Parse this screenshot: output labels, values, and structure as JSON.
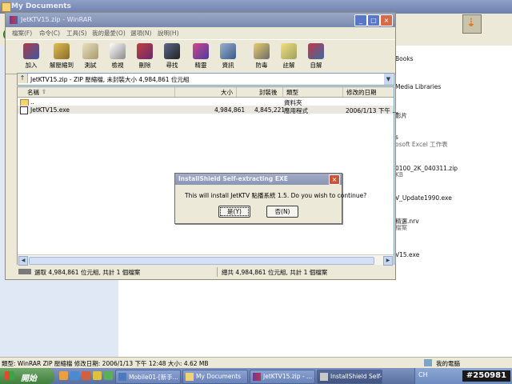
{
  "background_window": {
    "title": "My Documents",
    "right_items": [
      {
        "name": "Books",
        "detail": ""
      },
      {
        "name": "Media Libraries",
        "detail": ""
      },
      {
        "name": "影片",
        "detail": ""
      },
      {
        "name": "s",
        "detail": "osoft Excel 工作表"
      },
      {
        "name": "0100_2K_040311.zip",
        "detail": "KB"
      },
      {
        "name": "V_Update1990.exe",
        "detail": ""
      },
      {
        "name": "精選.nrv",
        "detail": "檔案"
      },
      {
        "name": "V15.exe",
        "detail": ""
      }
    ],
    "status_text": "類型: WinRAR ZIP 壓縮檔 修改日期: 2006/1/13 下午 12:48 大小: 4.62 MB",
    "status_right": "我的電腦"
  },
  "winrar": {
    "title": "JetKTV15.zip - WinRAR",
    "menu": [
      "檔案(F)",
      "命令(C)",
      "工具(S)",
      "我的最愛(O)",
      "選項(N)",
      "說明(H)"
    ],
    "toolbar": [
      "加入",
      "解壓縮到",
      "測試",
      "檢視",
      "刪除",
      "尋找",
      "精靈",
      "資訊",
      "防毒",
      "註解",
      "自解"
    ],
    "address": "JetKTV15.zip - ZIP 壓縮檔, 未封裝大小 4,984,861 位元組",
    "columns": [
      "名稱",
      "大小",
      "封裝後",
      "類型",
      "修改的日期"
    ],
    "rows": [
      {
        "name": "..",
        "size": "",
        "packed": "",
        "type": "資料夾",
        "modified": ""
      },
      {
        "name": "JetKTV15.exe",
        "size": "4,984,861",
        "packed": "4,845,221",
        "type": "應用程式",
        "modified": "2006/1/13 下午 ..."
      }
    ],
    "status_left": "選取 4,984,861 位元組, 共計 1 個檔案",
    "status_right": "總共 4,984,861 位元組, 共計 1 個檔案"
  },
  "dialog": {
    "title": "InstallShield Self-extracting EXE",
    "message": "This will install JetKTV 點播系統 1.5. Do you wish to continue?",
    "yes": "是(Y)",
    "no": "否(N)"
  },
  "taskbar": {
    "start": "開始",
    "tasks": [
      "Mobile01-[新手...",
      "My Documents",
      "JetKTV15.zip - ...",
      "InstallShield Self-..."
    ],
    "tray_ime": "CH",
    "watermark": "#250981"
  }
}
